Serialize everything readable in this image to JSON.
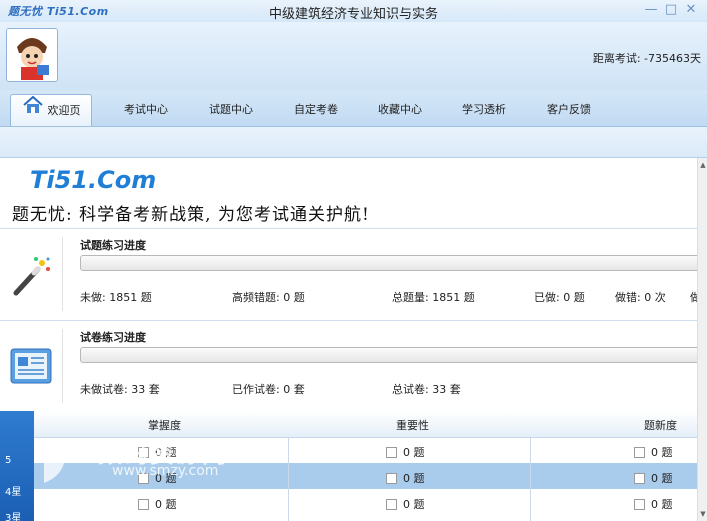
{
  "titlebar": {
    "brand": "题无忧 Ti51.Com",
    "title": "中级建筑经济专业知识与实务"
  },
  "header": {
    "countdown": "距离考试: -735463天"
  },
  "nav": {
    "tabs": [
      {
        "label": "欢迎页",
        "active": true
      },
      {
        "label": "考试中心"
      },
      {
        "label": "试题中心"
      },
      {
        "label": "自定考卷"
      },
      {
        "label": "收藏中心"
      },
      {
        "label": "学习透析"
      },
      {
        "label": "客户反馈"
      }
    ]
  },
  "banner": {
    "logo": "Ti51.Com",
    "slogan": "题无忧: 科学备考新战策, 为您考试通关护航!"
  },
  "question_progress": {
    "title": "试题练习进度",
    "progress": 0,
    "stats": [
      {
        "label": "未做: 1851 题"
      },
      {
        "label": "高频错题: 0 题"
      },
      {
        "label": "总题量: 1851 题"
      },
      {
        "label": "已做: 0 题"
      },
      {
        "label": "做错: 0 次"
      },
      {
        "label": "做"
      }
    ]
  },
  "paper_progress": {
    "title": "试卷练习进度",
    "progress": 0,
    "stats": [
      {
        "label": "未做试卷: 33 套"
      },
      {
        "label": "已作试卷: 0 套"
      },
      {
        "label": "总试卷: 33 套"
      }
    ]
  },
  "mastery_table": {
    "headers": [
      "掌握度",
      "重要性",
      "题新度"
    ],
    "rows": [
      {
        "star": "5",
        "cells": [
          "0 题",
          "0 题",
          "0 题"
        ]
      },
      {
        "star": "4星",
        "cells": [
          "0 题",
          "0 题",
          "0 题"
        ]
      },
      {
        "star": "3星",
        "cells": [
          "0 题",
          "0 题",
          "0 题"
        ]
      }
    ]
  },
  "watermark": {
    "text": "数码资源网",
    "sub": "www.smzy.com"
  },
  "colors": {
    "accent": "#1f7fd6",
    "selected_row": "#a9cbec",
    "star_column": "#1b5fb3"
  }
}
